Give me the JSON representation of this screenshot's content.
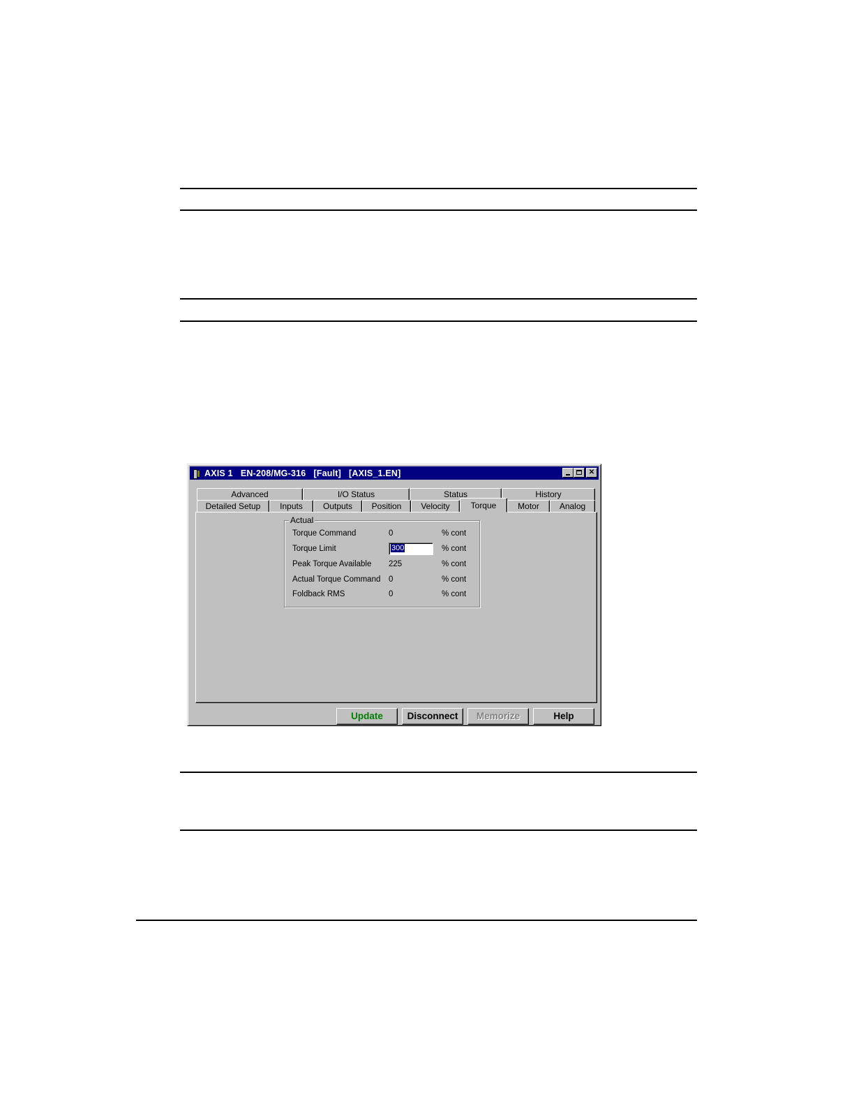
{
  "window": {
    "title": "AXIS 1   EN-208/MG-316   [Fault]   [AXIS_1.EN]"
  },
  "tabs": {
    "row1": [
      "Advanced",
      "I/O Status",
      "Status",
      "History"
    ],
    "row2": [
      "Detailed Setup",
      "Inputs",
      "Outputs",
      "Position",
      "Velocity",
      "Torque",
      "Motor",
      "Analog"
    ],
    "active": "Torque"
  },
  "group": {
    "label": "Actual",
    "rows": [
      {
        "label": "Torque Command",
        "value": "0",
        "unit": "% cont"
      },
      {
        "label": "Torque Limit",
        "value": "300",
        "unit": "% cont"
      },
      {
        "label": "Peak Torque Available",
        "value": "225",
        "unit": "% cont"
      },
      {
        "label": "Actual Torque Command",
        "value": "0",
        "unit": "% cont"
      },
      {
        "label": "Foldback RMS",
        "value": "0",
        "unit": "% cont"
      }
    ]
  },
  "buttons": {
    "update": "Update",
    "disconnect": "Disconnect",
    "memorize": "Memorize",
    "help": "Help"
  },
  "colors": {
    "titlebar": "#000080",
    "face": "#c0c0c0",
    "update_text": "#008000",
    "disabled_text": "#808080"
  }
}
